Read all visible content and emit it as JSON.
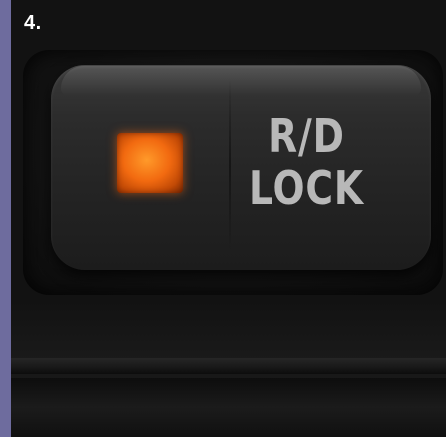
{
  "step": {
    "number": "4."
  },
  "switch": {
    "label_line1": "R/D",
    "label_line2": "LOCK",
    "indicator_state": "on",
    "indicator_color": "#f26a10"
  },
  "colors": {
    "frame": "#6e6c9e",
    "panel": "#121212",
    "label": "#b8b8b8"
  }
}
